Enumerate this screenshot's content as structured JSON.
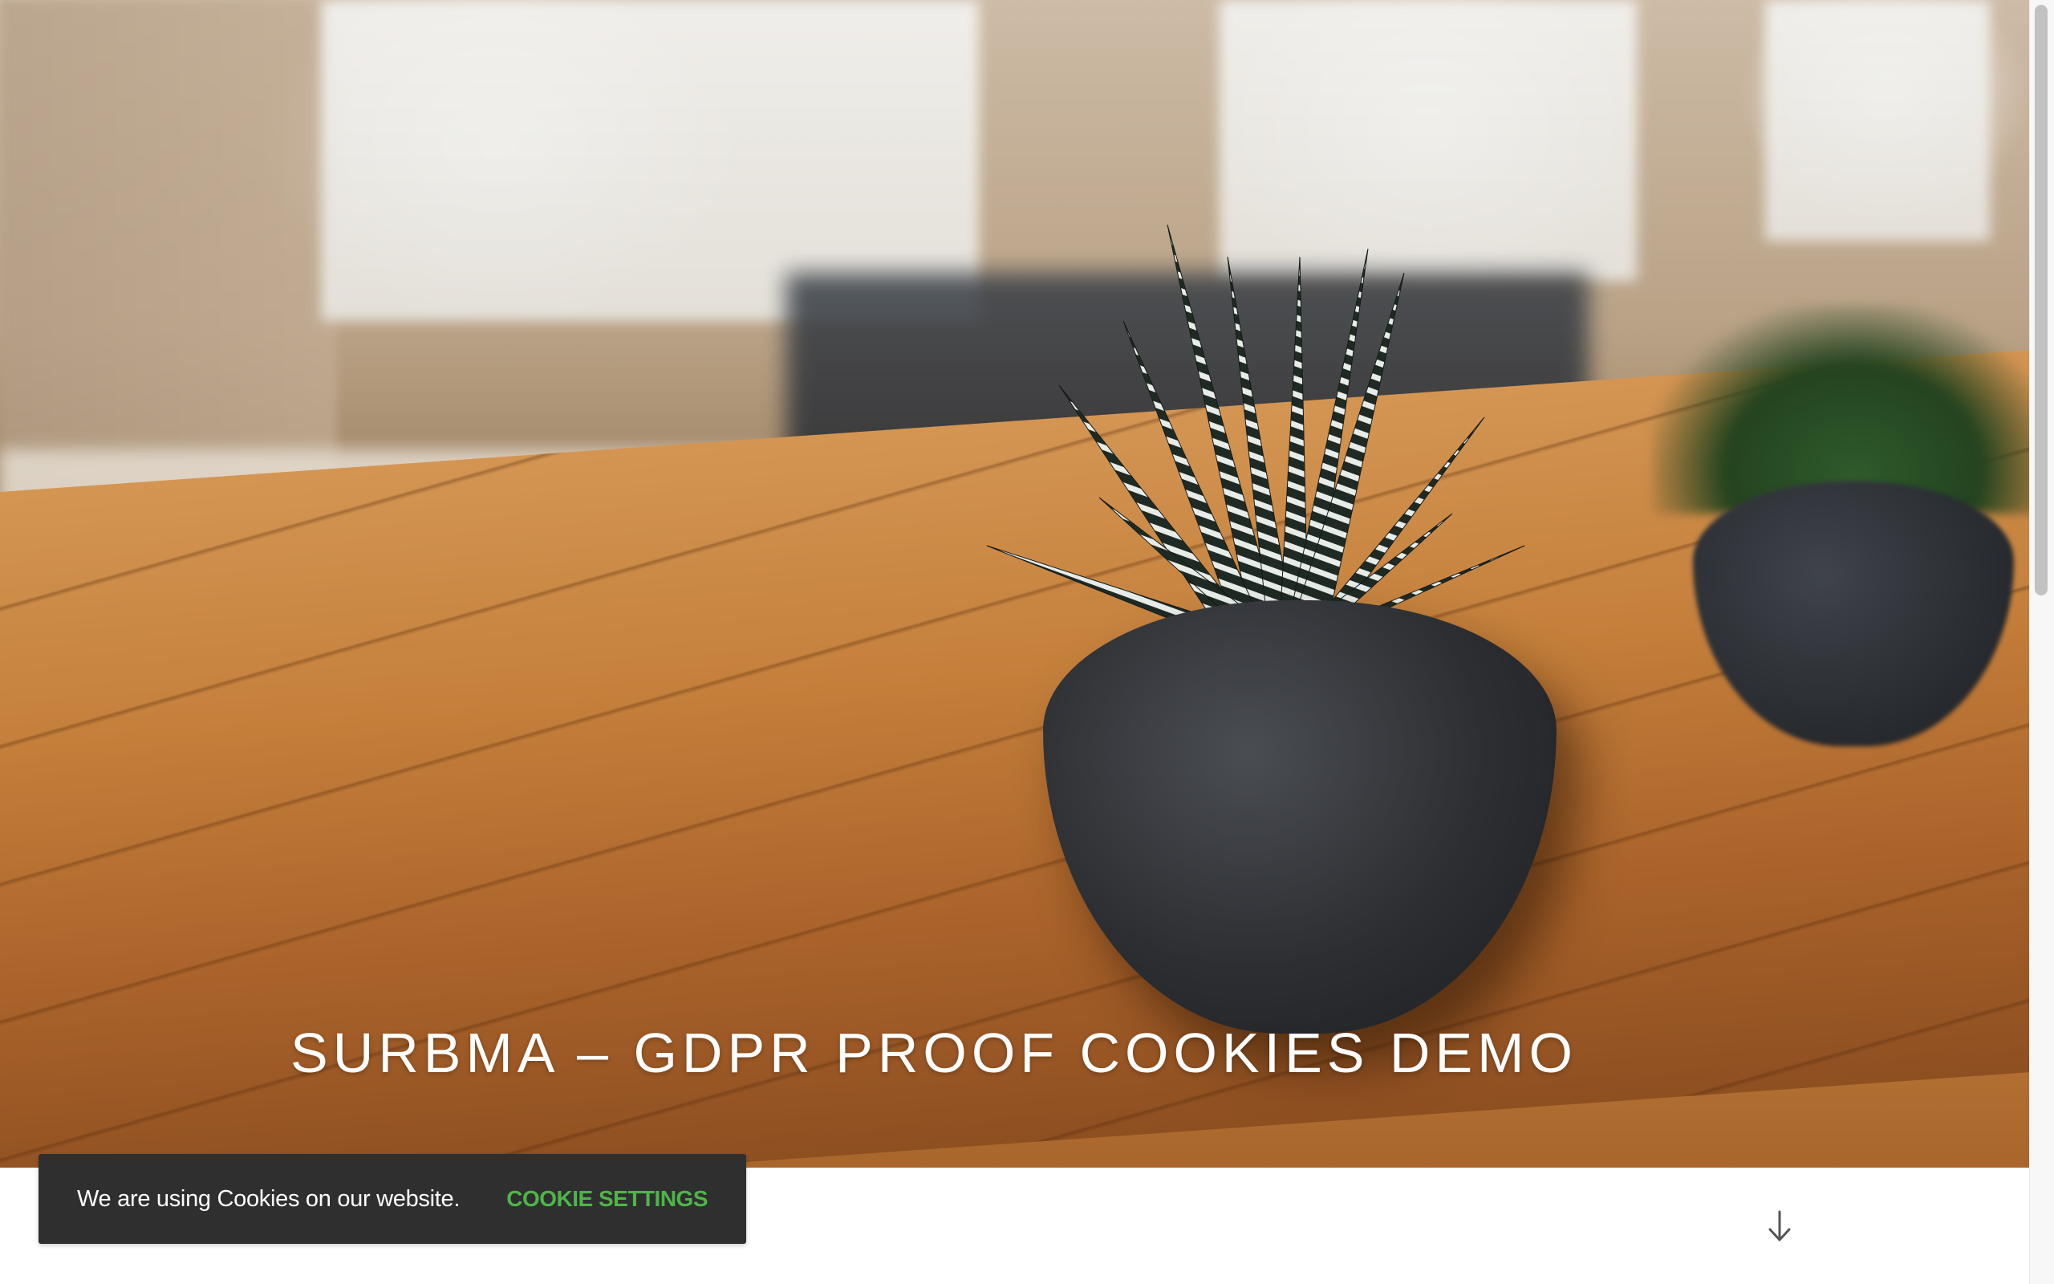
{
  "hero": {
    "title": "SURBMA – GDPR PROOF COOKIES DEMO",
    "image_subject": "plant-photo"
  },
  "cookie_notice": {
    "message": "We are using Cookies on our website.",
    "settings_label": "COOKIE SETTINGS",
    "background_color": "#2f2f2f",
    "accent_color": "#4fb54a"
  },
  "scroll_down": {
    "icon": "arrow-down-icon"
  }
}
